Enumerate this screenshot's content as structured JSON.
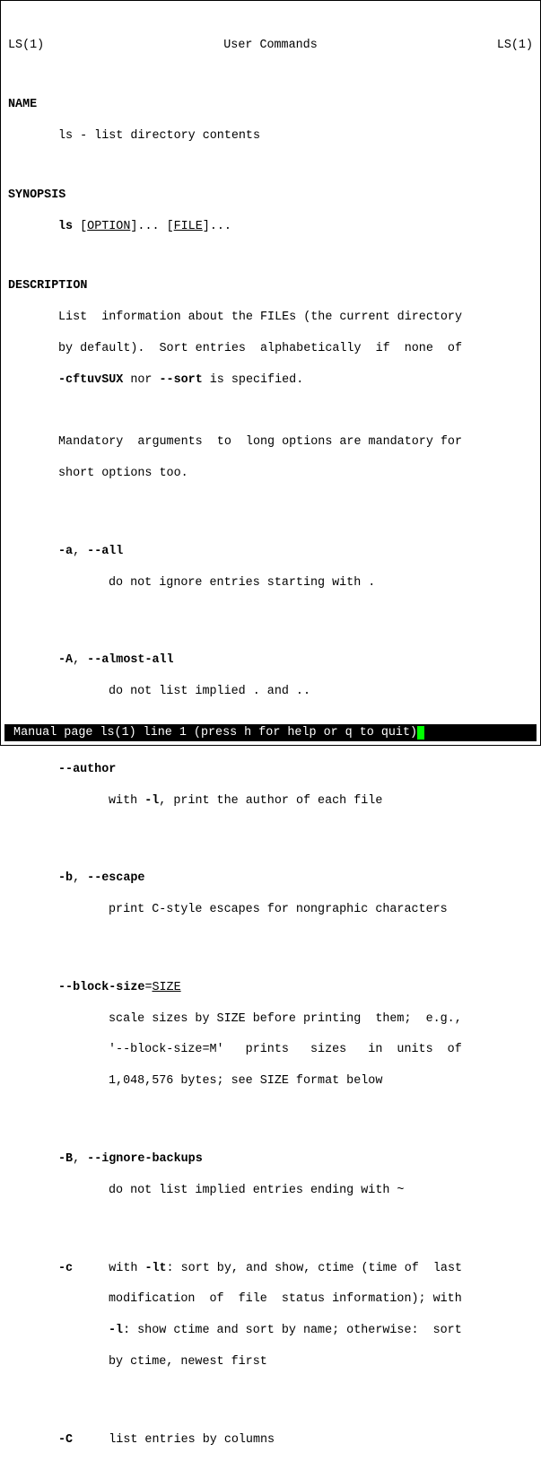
{
  "header": {
    "left": "LS(1)",
    "center": "User Commands",
    "right": "LS(1)"
  },
  "sections": {
    "name": {
      "title": "NAME",
      "text": "ls - list directory contents"
    },
    "synopsis": {
      "title": "SYNOPSIS",
      "cmd": "ls",
      "option": "OPTION",
      "file": "FILE",
      "ellipsis": "..."
    },
    "description": {
      "title": "DESCRIPTION",
      "para1_a": "List  information about the FILEs (the current directory",
      "para1_b": "by default).  Sort entries  alphabetically  if  none  of",
      "para1_c_prefix": "",
      "flags1": "-cftuvSUX",
      "nor": " nor ",
      "flags2": "--sort",
      "para1_c_suffix": " is specified.",
      "para2_a": "Mandatory  arguments  to  long options are mandatory for",
      "para2_b": "short options too."
    },
    "options": {
      "a": {
        "short": "-a",
        "long": "--all",
        "desc": "do not ignore entries starting with ."
      },
      "A": {
        "short": "-A",
        "long": "--almost-all",
        "desc": "do not list implied . and .."
      },
      "author": {
        "long": "--author",
        "with": "with ",
        "l": "-l",
        "rest": ", print the author of each file"
      },
      "b": {
        "short": "-b",
        "long": "--escape",
        "desc": "print C-style escapes for nongraphic characters"
      },
      "blocksize": {
        "long": "--block-size",
        "arg": "SIZE",
        "desc_a": "scale sizes by SIZE before printing  them;  e.g.,",
        "desc_b": "'--block-size=M'   prints   sizes   in  units  of",
        "desc_c": "1,048,576 bytes; see SIZE format below"
      },
      "B": {
        "short": "-B",
        "long": "--ignore-backups",
        "desc": "do not list implied entries ending with ~"
      },
      "c": {
        "short": "-c",
        "pre": "     with ",
        "lt": "-lt",
        "t1": ": sort by, and show, ctime (time of  last",
        "line2": "modification  of  file  status information); with",
        "l": "-l",
        "t2": ": show ctime and sort by name; otherwise:  sort",
        "line4": "by ctime, newest first"
      },
      "C": {
        "short": "-C",
        "desc": "     list entries by columns"
      }
    }
  },
  "status": " Manual page ls(1) line 1 (press h for help or q to quit)"
}
